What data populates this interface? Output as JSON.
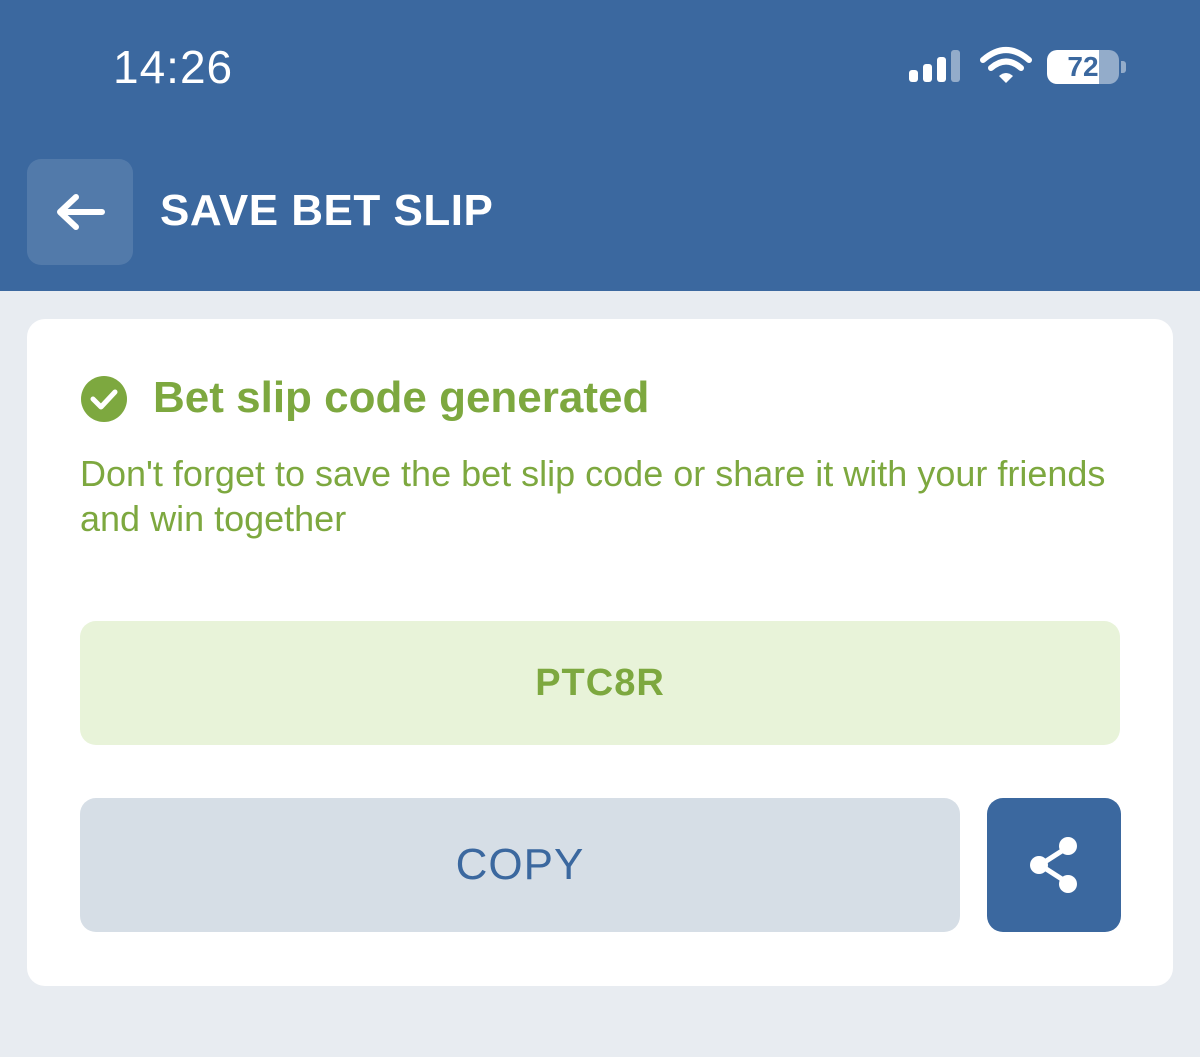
{
  "status_bar": {
    "time": "14:26",
    "battery_level": "72",
    "battery_fraction": 0.72,
    "icons": [
      "signal-icon",
      "wifi-icon",
      "battery-icon"
    ]
  },
  "header": {
    "back_icon": "arrow-left-icon",
    "title": "SAVE BET SLIP"
  },
  "card": {
    "status_icon": "check-circle-icon",
    "title": "Bet slip code generated",
    "description": "Don't forget to save the bet slip code or share it with your friends and win together",
    "code": "PTC8R",
    "copy_label": "COPY",
    "share_icon": "share-icon"
  },
  "colors": {
    "header_bg": "#3b689f",
    "page_bg": "#e8ecf1",
    "success_green": "#7da83f",
    "code_bg": "#e8f3d9",
    "copy_bg": "#d6dee6"
  }
}
